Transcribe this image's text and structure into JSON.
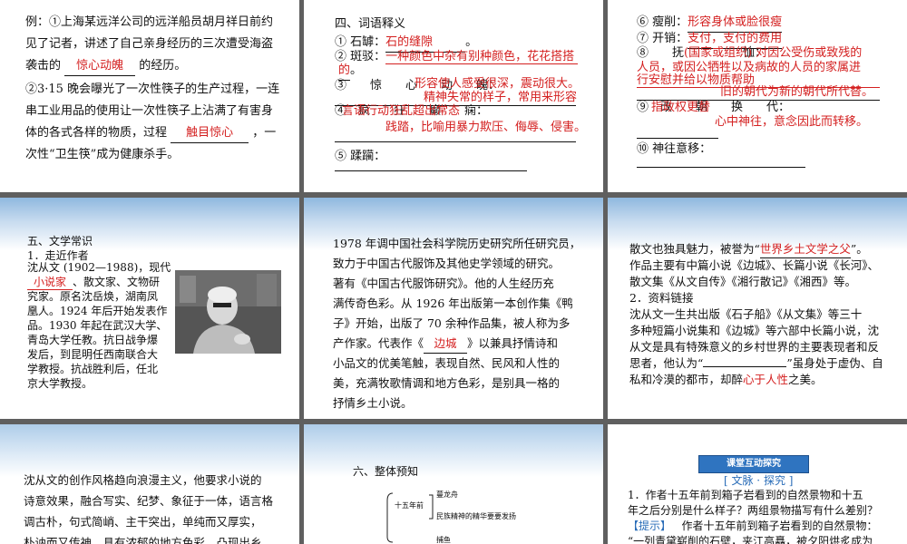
{
  "s1": {
    "l1": "例：①上海某远洋公司的远洋船员胡月祥日前约",
    "l2": "见了记者，讲述了自己亲身经历的三次遭受海盗",
    "l3a": "袭击的",
    "l3ans": "惊心动魄",
    "l3b": "的经历。",
    "l4": "②3·15 晚会曝光了一次性筷子的生产过程，一连",
    "l5": "串工业用品的使用让一次性筷子上沾满了有害身",
    "l6a": "体的各式各样的物质，过程",
    "l6ans": "触目惊心",
    "l6b": "，一",
    "l7": "次性“卫生筷”成为健康杀手。"
  },
  "s2": {
    "heading": "四、词语释义",
    "i1": "① 石罅：",
    "i1a": "石的缝隙",
    "i1p": "。",
    "i2": "② 斑驳：",
    "i2a": "一种颜色中杂有别种颜色，花花搭搭",
    "i2b": "的",
    "i2p": "。",
    "i3": "③　　惊　　心　　动　　魄：",
    "i3a": "形容使人感受很深，震动很大。",
    "i3b": "精神失常的样子，常用来形容",
    "i4": "④　疯　　狂　　癫　　痫：",
    "i4a": "言语行动狂乱超出常态",
    "i4b": "践踏，比喻用暴力欺压、侮辱、侵害。",
    "i5": "⑤ 蹂躏："
  },
  "s3": {
    "i6": "⑥ 瘦削：",
    "i6a": "形容身体或脸很瘦",
    "i7": "⑦ 开销：",
    "i7a": "支付，支付的费用",
    "i8": "⑧　　抚　　　　　恤：",
    "i8a": "(国家或组织) 对因公受伤或致残的",
    "i8b": "人员，或因公牺牲以及病故的人员的家属进",
    "i8c": "行安慰并给以物质帮助",
    "i8d": "旧的朝代为新的朝代所代替。",
    "i9": "⑨　改　　朝　　换　　代：",
    "i9a": "指政权更替",
    "i9b": "心中神往，意念因此而转移。",
    "i10": "⑩ 神往意移："
  },
  "s4": {
    "heading": "五、文学常识",
    "sub": "1．走近作者",
    "l1": "沈从文 (1902—1988)，现代",
    "l2ans": "小说家",
    "l2": "、散文家、文物研",
    "l3": "究家。原名沈岳焕，湖南凤",
    "l4": "凰人。1924 年后开始发表作",
    "l5": "品。1930 年起在武汉大学、",
    "l6": "青岛大学任教。抗日战争爆",
    "l7": "发后，到昆明任西南联合大",
    "l8": "学教授。抗战胜利后，任北",
    "l9": "京大学教授。"
  },
  "s5": {
    "l1": "1978 年调中国社会科学院历史研究所任研究员，",
    "l2": "致力于中国古代服饰及其他史学领域的研究。",
    "l3": "著有《中国古代服饰研究》。他的人生经历充",
    "l4": "满传奇色彩。从 1926 年出版第一本创作集《鸭",
    "l5": "子》开始，出版了 70 余种作品集，被人称为多",
    "l6a": "产作家。代表作《",
    "l6ans": "边城",
    "l6b": "》以兼具抒情诗和",
    "l7": "小品文的优美笔触，表现自然、民风和人性的",
    "l8": "美，充满牧歌情调和地方色彩，是别具一格的",
    "l9": "抒情乡土小说。"
  },
  "s6": {
    "l1a": "散文也独具魅力，被誉为“",
    "l1ans": "世界乡土文学之父",
    "l1b": "”。",
    "l2": "作品主要有中篇小说《边城》、长篇小说《长河》、",
    "l3": "散文集《从文自传》《湘行散记》《湘西》等。",
    "sub": "2．资料链接",
    "l4": "沈从文一生共出版《石子船》《从文集》等三十",
    "l5": "多种短篇小说集和《边城》等六部中长篇小说，沈",
    "l6": "从文是具有特殊意义的乡村世界的主要表现者和反",
    "l7a": "思者，他认为“",
    "l7b": "”虽身处于虚伪、自",
    "l8a": "私和冷漠的都市，却醉",
    "l8ans": "心于人性",
    "l8b": "之美。"
  },
  "s7": {
    "l1": "沈从文的创作风格趋向浪漫主义，他要求小说的",
    "l2": "诗意效果，融合写实、纪梦、象征于一体，语言格",
    "l3": "调古朴，句式简峭、主干突出，单纯而又厚实，",
    "l4": "朴讷而又传神，具有浓郁的地方色彩，凸现出乡"
  },
  "s8": {
    "heading": "六、整体预知",
    "node1": "十五年前",
    "leaf1": "蔓龙舟",
    "leaf2": "民族精神的精华要要发扬",
    "leaf3": "捕鱼"
  },
  "s9": {
    "button": "课堂互动探究",
    "section": "[ 文脉 · 探究 ]",
    "q1": "1．作者十五年前到箱子岩看到的自然景物和十五",
    "q2": "年之后分别是什么样子？两组景物描写有什么差别？",
    "hint": "【提示】",
    "a1": "作者十五年前到箱子岩看到的自然景物：",
    "a2": "“一列青黛崭削的石壁，夹江高矗，被夕阳烘炙成为"
  },
  "colors": {
    "answer_red": "#d42020",
    "band_blue": "#8fb8df",
    "button_blue": "#2f74c0"
  }
}
